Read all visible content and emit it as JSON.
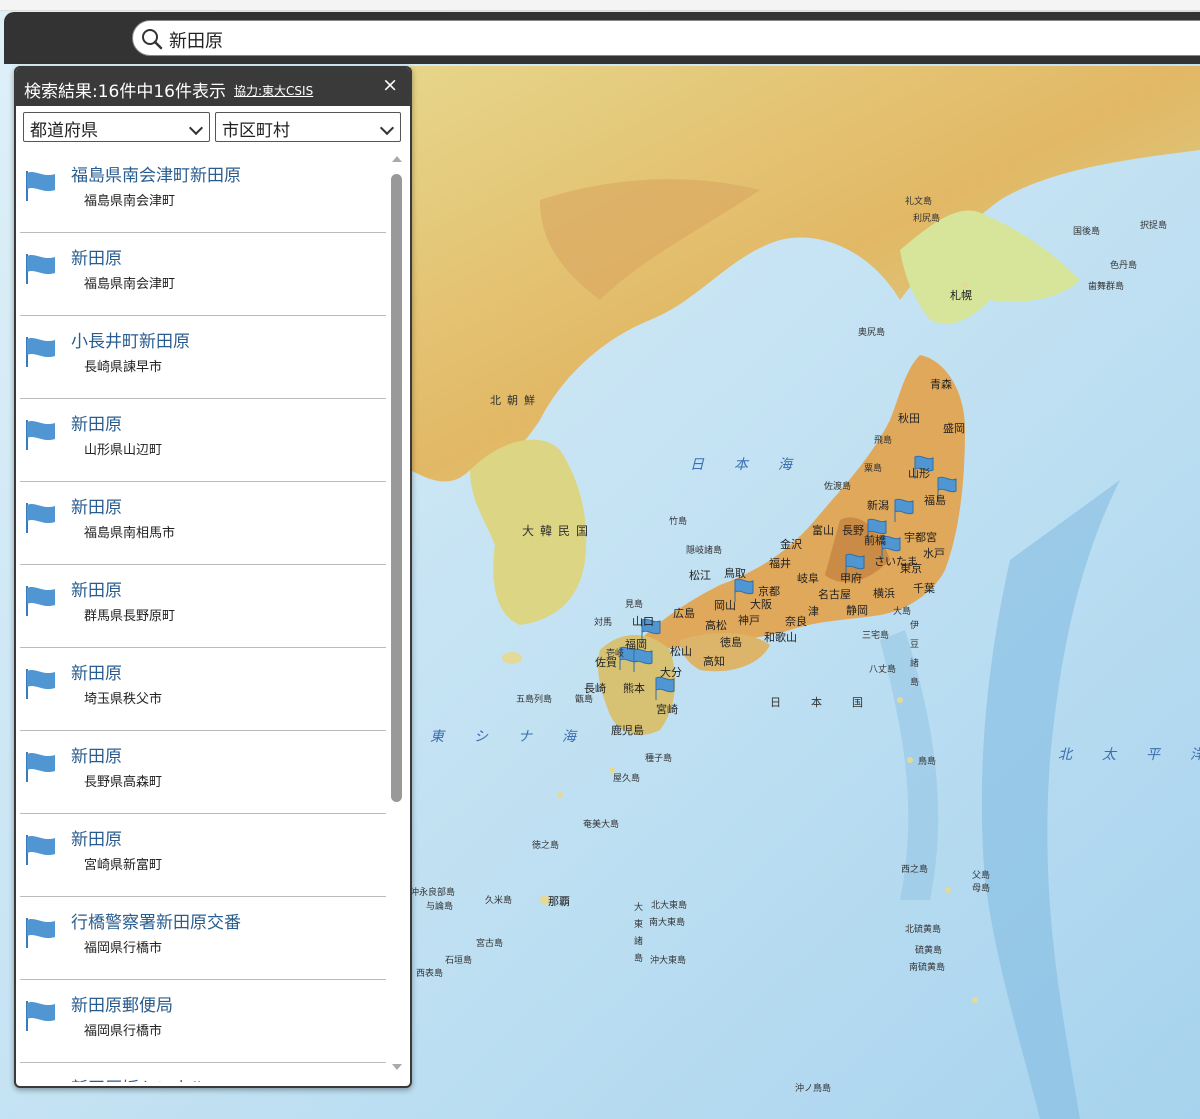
{
  "search": {
    "query": "新田原"
  },
  "panel": {
    "title": "検索結果:16件中16件表示",
    "credit": "協力:東大CSIS",
    "close_icon": "×",
    "prefecture_select": "都道府県",
    "city_select": "市区町村"
  },
  "results": [
    {
      "name": "福島県南会津町新田原",
      "address": "福島県南会津町"
    },
    {
      "name": "新田原",
      "address": "福島県南会津町"
    },
    {
      "name": "小長井町新田原",
      "address": "長崎県諫早市"
    },
    {
      "name": "新田原",
      "address": "山形県山辺町"
    },
    {
      "name": "新田原",
      "address": "福島県南相馬市"
    },
    {
      "name": "新田原",
      "address": "群馬県長野原町"
    },
    {
      "name": "新田原",
      "address": "埼玉県秩父市"
    },
    {
      "name": "新田原",
      "address": "長野県高森町"
    },
    {
      "name": "新田原",
      "address": "宮崎県新富町"
    },
    {
      "name": "行橋警察署新田原交番",
      "address": "福岡県行橋市"
    },
    {
      "name": "新田原郵便局",
      "address": "福岡県行橋市"
    },
    {
      "name": "新田原坂トンネル",
      "address": ""
    }
  ],
  "map": {
    "seas": [
      "日本海",
      "東シナ海",
      "北太平洋",
      "日本国"
    ],
    "regions": [
      "北朝鮮",
      "大韓民国"
    ],
    "cities": [
      "札幌",
      "青森",
      "秋田",
      "盛岡",
      "山形",
      "福島",
      "宇都宮",
      "水戸",
      "前橋",
      "さいたま",
      "東京",
      "千葉",
      "横浜",
      "甲府",
      "長野",
      "新潟",
      "富山",
      "金沢",
      "福井",
      "岐阜",
      "名古屋",
      "静岡",
      "津",
      "大阪",
      "京都",
      "神戸",
      "奈良",
      "和歌山",
      "鳥取",
      "松江",
      "岡山",
      "広島",
      "山口",
      "高松",
      "徳島",
      "松山",
      "高知",
      "福岡",
      "佐賀",
      "長崎",
      "熊本",
      "大分",
      "宮崎",
      "鹿児島",
      "那覇"
    ],
    "islands": [
      "礼文島",
      "利尻島",
      "国後島",
      "択捉島",
      "色丹島",
      "歯舞群島",
      "奥尻島",
      "飛島",
      "粟島",
      "佐渡島",
      "竹島",
      "隠岐諸島",
      "見島",
      "対馬",
      "壱岐",
      "五島列島",
      "甑島",
      "種子島",
      "屋久島",
      "奄美大島",
      "徳之島",
      "沖永良部島",
      "与論島",
      "久米島",
      "宮古島",
      "石垣島",
      "西表島",
      "大東諸島",
      "北大東島",
      "南大東島",
      "沖大東島",
      "大島",
      "三宅島",
      "八丈島",
      "伊豆諸島",
      "鳥島",
      "西之島",
      "父島",
      "母島",
      "硫黄島",
      "北硫黄島",
      "南硫黄島",
      "沖ノ鳥島"
    ]
  },
  "colors": {
    "accent": "#2a5d8f",
    "flag": "#4f96d2",
    "panel_header": "#3a3a3a"
  }
}
